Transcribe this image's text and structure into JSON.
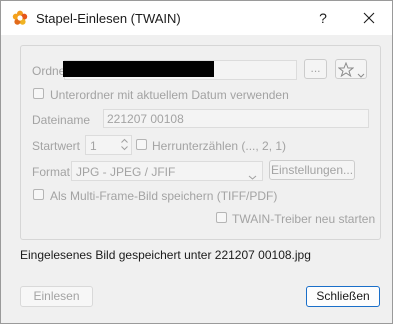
{
  "window": {
    "title": "Stapel-Einlesen (TWAIN)",
    "help_label": "?",
    "app_icon": "xnview-flower-icon",
    "close_icon": "close-icon"
  },
  "form": {
    "folder_label": "Ordner",
    "folder_value": "",
    "browse_label": "...",
    "favorite_icon": "star-icon",
    "subfolder_label": "Unterordner mit aktuellem Datum verwenden",
    "subfolder_checked": false,
    "filename_label": "Dateiname",
    "filename_value": "221207 00108",
    "start_label": "Startwert",
    "start_value": "1",
    "countdown_label": "Herrunterzählen (..., 2, 1)",
    "countdown_checked": false,
    "format_label": "Format",
    "format_value": "JPG - JPEG / JFIF",
    "settings_label": "Einstellungen...",
    "multiframe_label": "Als Multi-Frame-Bild speichern (TIFF/PDF)",
    "multiframe_checked": false,
    "restart_label": "TWAIN-Treiber neu starten",
    "restart_checked": false
  },
  "status_text": "Eingelesenes Bild gespeichert unter 221207 00108.jpg",
  "buttons": {
    "read_label": "Einlesen",
    "close_label": "Schließen"
  },
  "colors": {
    "accent": "#1a6fc9",
    "disabled_text": "#a3a3a3",
    "redaction": "#000000"
  }
}
